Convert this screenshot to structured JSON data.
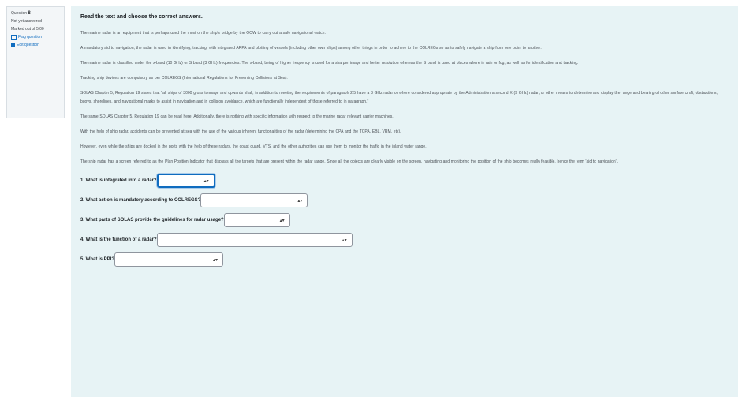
{
  "sidebar": {
    "question_label": "Question",
    "question_number": "8",
    "status": "Not yet answered",
    "marks": "Marked out of 5.00",
    "flag_label": "Flag question",
    "edit_label": "Edit question"
  },
  "main": {
    "instruction": "Read the text and choose the correct answers.",
    "paragraphs": [
      "The marine radar is an equipment that is perhaps used the most on the ship's bridge by the OOW to carry out a safe navigational watch.",
      "A mandatory aid to navigation, the radar is used in identifying, tracking, with integrated ARPA and plotting of vessels (including other own ships) among other things in order to adhere to the COLREGs so as to safely navigate a ship from one point to another.",
      "The marine radar is classified under the x-band (10 GHz) or S band (3 GHz) frequencies. The x-band, being of higher frequency is used for a sharper image and better resolution whereas the S band is used at places where in rain or fog, as well as for identification and tracking.",
      "Tracking ship devices are compulsory as per COLREGS (International Regulations for Preventing Collisions at Sea).",
      "SOLAS Chapter 5, Regulation 19 states that \"all ships of 3000 gross tonnage and upwards shall, in addition to meeting the requirements of paragraph 2.5 have a 3 GHz radar or where considered appropriate by the Administration a second X (9 GHz) radar, or other means to determine and display the range and bearing of other surface craft, obstructions, buoys, shorelines, and navigational marks to assist in navigation and in collision avoidance, which are functionally independent of those referred to in paragraph.\"",
      "The same SOLAS Chapter 5, Regulation 19 can be read here. Additionally, there is nothing with specific information with respect to the marine radar relevant carrier machines.",
      "With the help of ship radar, accidents can be prevented at sea with the use of the various inherent functionalities of the radar (determining the CPA and the TCPA, EBL, VRM, etc).",
      "However, even while the ships are docked in the ports with the help of these radars, the coast guard, VTS, and the other authorities can use them to monitor the traffic in the inland water range.",
      "The ship radar has a screen referred to as the Plan Position Indicator that displays all the targets that are present within the radar range. Since all the objects are clearly visible on the screen, navigating and monitoring the position of the ship becomes really feasible, hence the term 'aid to navigation'."
    ],
    "questions": [
      {
        "label": "1. What is integrated into a radar?",
        "value": ""
      },
      {
        "label": "2. What action is mandatory according to COLREGS?",
        "value": ""
      },
      {
        "label": "3. What parts of SOLAS provide the guidelines for radar usage?",
        "value": ""
      },
      {
        "label": "4. What is the function of a radar?",
        "value": ""
      },
      {
        "label": "5. What is PPI?",
        "value": ""
      }
    ],
    "caret_icon": "▴▾"
  }
}
